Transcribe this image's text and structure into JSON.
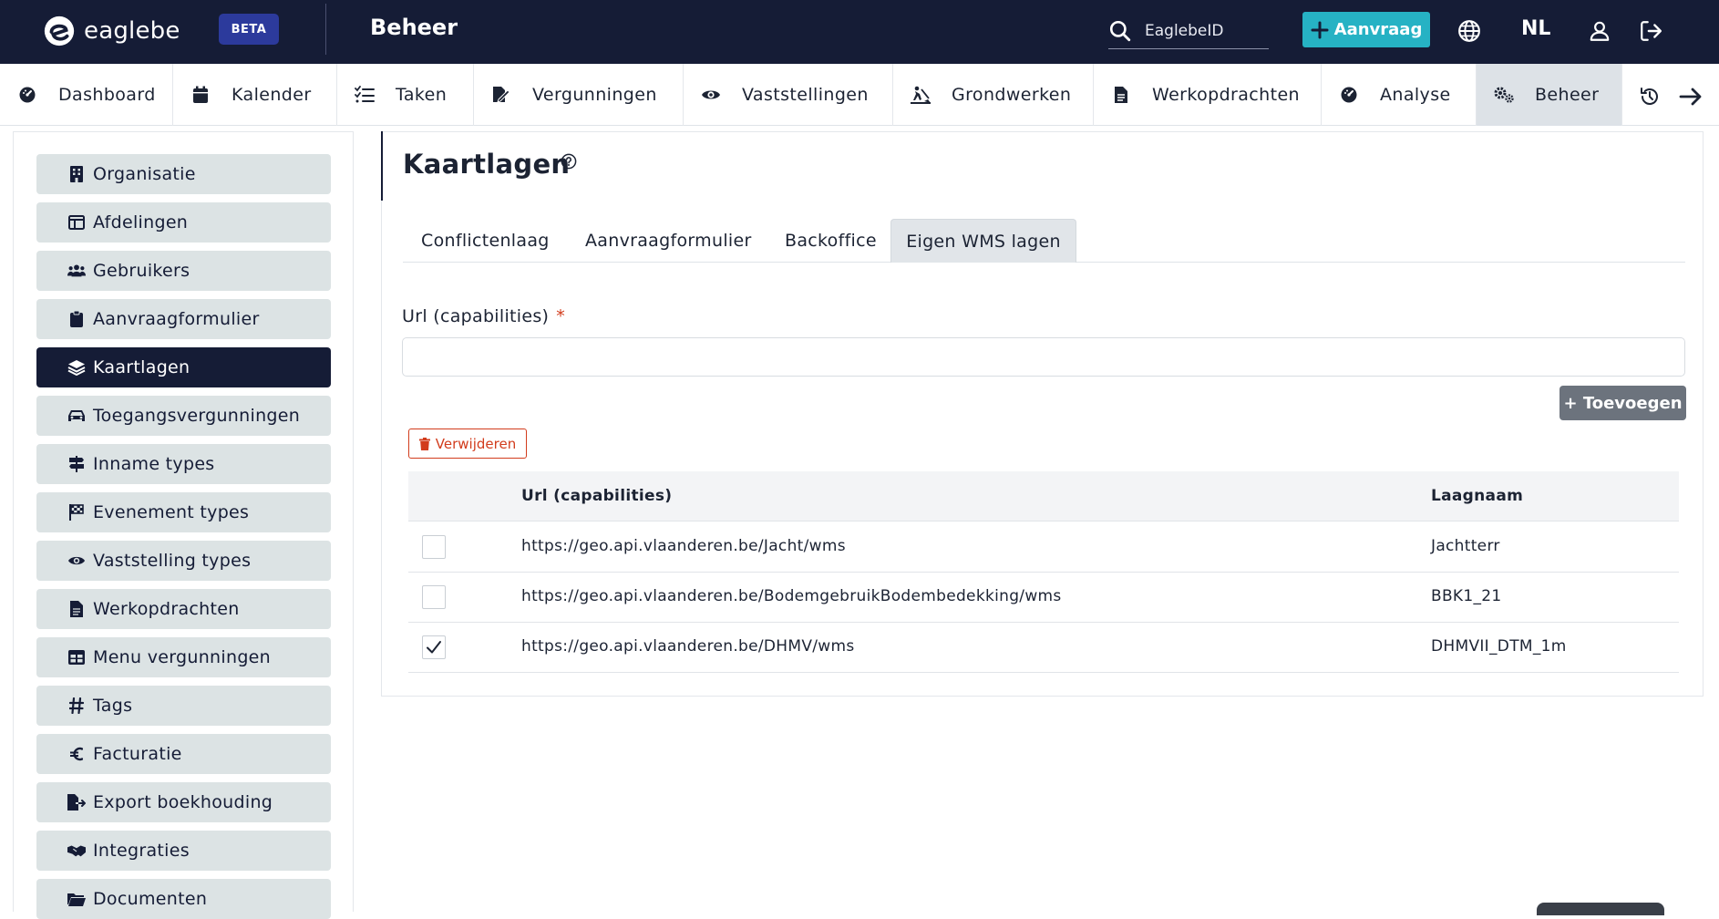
{
  "header": {
    "logo_text": "eaglebe",
    "beta_label": "BETA",
    "section_title": "Beheer",
    "search_placeholder": "EaglebeID",
    "new_request_label": "Aanvraag",
    "language": "NL"
  },
  "nav": {
    "items": [
      {
        "label": "Dashboard",
        "icon": "dashboard-icon"
      },
      {
        "label": "Kalender",
        "icon": "calendar-icon"
      },
      {
        "label": "Taken",
        "icon": "tasks-icon"
      },
      {
        "label": "Vergunningen",
        "icon": "permit-icon"
      },
      {
        "label": "Vaststellingen",
        "icon": "eye-icon"
      },
      {
        "label": "Grondwerken",
        "icon": "digging-icon"
      },
      {
        "label": "Werkopdrachten",
        "icon": "file-icon"
      },
      {
        "label": "Analyse",
        "icon": "analysis-icon"
      },
      {
        "label": "Beheer",
        "icon": "gears-icon",
        "active": true
      }
    ]
  },
  "sidebar": {
    "items": [
      {
        "label": "Organisatie",
        "icon": "building-icon"
      },
      {
        "label": "Afdelingen",
        "icon": "table-icon"
      },
      {
        "label": "Gebruikers",
        "icon": "users-icon"
      },
      {
        "label": "Aanvraagformulier",
        "icon": "clipboard-icon"
      },
      {
        "label": "Kaartlagen",
        "icon": "layers-icon",
        "active": true
      },
      {
        "label": "Toegangsvergunningen",
        "icon": "car-icon"
      },
      {
        "label": "Inname types",
        "icon": "signpost-icon"
      },
      {
        "label": "Evenement types",
        "icon": "flag-icon"
      },
      {
        "label": "Vaststelling types",
        "icon": "eye-icon"
      },
      {
        "label": "Werkopdrachten",
        "icon": "file-icon"
      },
      {
        "label": "Menu vergunningen",
        "icon": "grid-icon"
      },
      {
        "label": "Tags",
        "icon": "hash-icon"
      },
      {
        "label": "Facturatie",
        "icon": "euro-icon"
      },
      {
        "label": "Export boekhouding",
        "icon": "file-export-icon"
      },
      {
        "label": "Integraties",
        "icon": "handshake-icon"
      },
      {
        "label": "Documenten",
        "icon": "folder-icon"
      }
    ]
  },
  "main": {
    "title": "Kaartlagen",
    "tabs": [
      {
        "label": "Conflictenlaag"
      },
      {
        "label": "Aanvraagformulier"
      },
      {
        "label": "Backoffice"
      },
      {
        "label": "Eigen WMS lagen",
        "active": true
      }
    ],
    "form": {
      "url_label": "Url (capabilities)",
      "required_mark": "*",
      "url_value": "",
      "add_label": "+ Toevoegen"
    },
    "delete_label": "Verwijderen",
    "table": {
      "headers": [
        "Url (capabilities)",
        "Laagnaam"
      ],
      "rows": [
        {
          "url": "https://geo.api.vlaanderen.be/Jacht/wms",
          "layer": "Jachtterr",
          "checked": false
        },
        {
          "url": "https://geo.api.vlaanderen.be/BodemgebruikBodembedekking/wms",
          "layer": "BBK1_21",
          "checked": false
        },
        {
          "url": "https://geo.api.vlaanderen.be/DHMV/wms",
          "layer": "DHMVII_DTM_1m",
          "checked": true
        }
      ]
    }
  },
  "colors": {
    "topbar": "#151c36",
    "accent": "#26b2c4",
    "danger": "#d23c1c",
    "sidebar_item": "#dce3e4"
  }
}
